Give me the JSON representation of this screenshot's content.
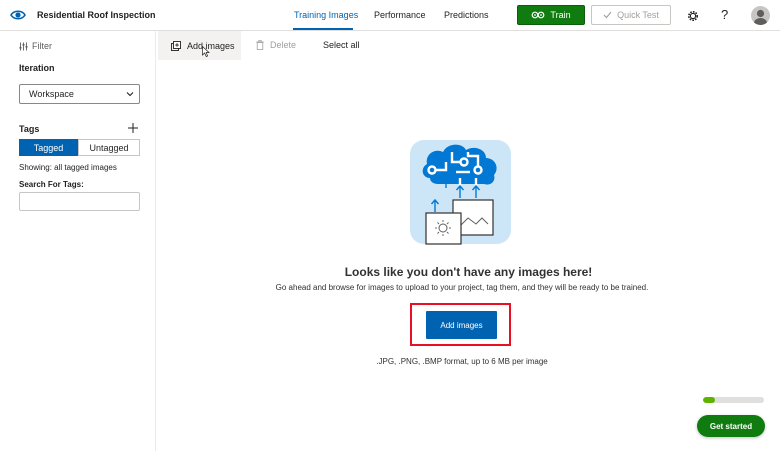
{
  "header": {
    "app_title": "Residential Roof Inspection",
    "tabs": [
      {
        "label": "Training Images",
        "active": true
      },
      {
        "label": "Performance",
        "active": false
      },
      {
        "label": "Predictions",
        "active": false
      }
    ],
    "train_label": "Train",
    "quick_test_label": "Quick Test",
    "settings_icon": "gear-icon",
    "help_label": "?",
    "accent_color": "#0063b1",
    "train_color": "#107c10"
  },
  "sidebar": {
    "filter_label": "Filter",
    "iteration_label": "Iteration",
    "iteration_value": "Workspace",
    "tags_label": "Tags",
    "tagged_label": "Tagged",
    "untagged_label": "Untagged",
    "showing_text": "Showing: all tagged images",
    "search_label": "Search For Tags:",
    "search_value": ""
  },
  "commandbar": {
    "add_images_label": "Add images",
    "delete_label": "Delete",
    "select_all_label": "Select all"
  },
  "empty_state": {
    "title": "Looks like you don't have any images here!",
    "subtitle": "Go ahead and browse for images to upload to your project, tag them, and they will be ready to be trained.",
    "button_label": "Add images",
    "format_note": ".JPG, .PNG, .BMP format, up to 6 MB per image"
  },
  "get_started": {
    "label": "Get started",
    "progress_percent": 20,
    "progress_color": "#5db300"
  }
}
